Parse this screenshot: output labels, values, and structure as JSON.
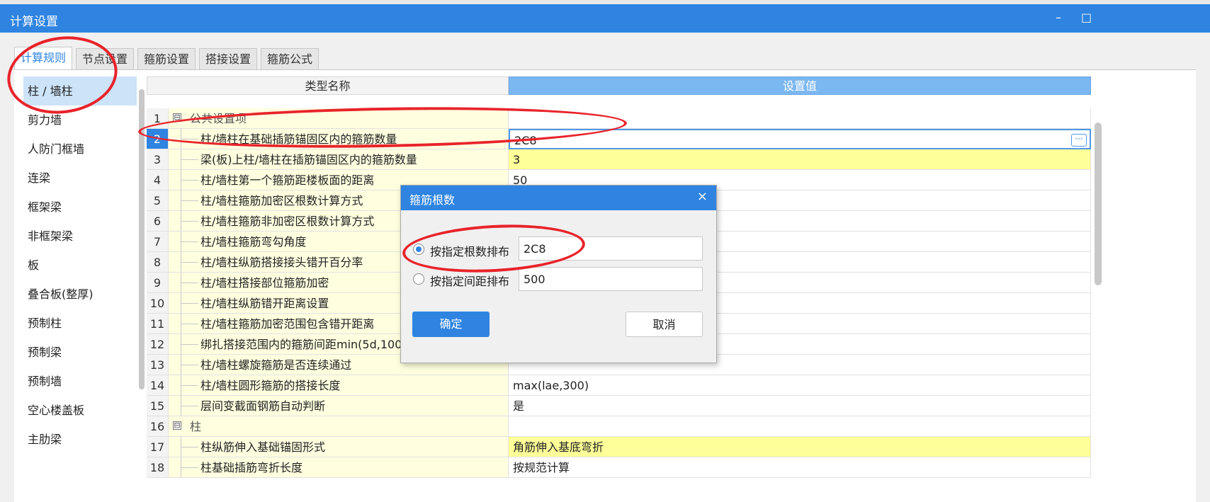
{
  "window": {
    "title": "计算设置",
    "minimize": "–",
    "maximize": "□"
  },
  "tabs": [
    {
      "label": "计算规则",
      "active": true
    },
    {
      "label": "节点设置"
    },
    {
      "label": "箍筋设置"
    },
    {
      "label": "搭接设置"
    },
    {
      "label": "箍筋公式"
    }
  ],
  "sidebar": {
    "items": [
      {
        "label": "柱 / 墙柱",
        "active": true
      },
      {
        "label": "剪力墙"
      },
      {
        "label": "人防门框墙"
      },
      {
        "label": "连梁"
      },
      {
        "label": "框架梁"
      },
      {
        "label": "非框架梁"
      },
      {
        "label": "板"
      },
      {
        "label": "叠合板(整厚)"
      },
      {
        "label": "预制柱"
      },
      {
        "label": "预制梁"
      },
      {
        "label": "预制墙"
      },
      {
        "label": "空心楼盖板"
      },
      {
        "label": "主肋梁"
      }
    ]
  },
  "grid": {
    "columns": {
      "name": "类型名称",
      "value": "设置值"
    },
    "rows": [
      {
        "num": "1",
        "group": true,
        "toggle": "⊟",
        "name": "公共设置项",
        "value": ""
      },
      {
        "num": "2",
        "name": "柱/墙柱在基础插筋锚固区内的箍筋数量",
        "value": "2C8",
        "selected": true
      },
      {
        "num": "3",
        "name": "梁(板)上柱/墙柱在插筋锚固区内的箍筋数量",
        "value": "3",
        "yellow": true
      },
      {
        "num": "4",
        "name": "柱/墙柱第一个箍筋距楼板面的距离",
        "value": "50"
      },
      {
        "num": "5",
        "name": "柱/墙柱箍筋加密区根数计算方式",
        "value": ""
      },
      {
        "num": "6",
        "name": "柱/墙柱箍筋非加密区根数计算方式",
        "value": ""
      },
      {
        "num": "7",
        "name": "柱/墙柱箍筋弯勾角度",
        "value": ""
      },
      {
        "num": "8",
        "name": "柱/墙柱纵筋搭接接头错开百分率",
        "value": ""
      },
      {
        "num": "9",
        "name": "柱/墙柱搭接部位箍筋加密",
        "value": ""
      },
      {
        "num": "10",
        "name": "柱/墙柱纵筋错开距离设置",
        "value": ""
      },
      {
        "num": "11",
        "name": "柱/墙柱箍筋加密范围包含错开距离",
        "value": ""
      },
      {
        "num": "12",
        "name": "绑扎搭接范围内的箍筋间距min(5d,100",
        "value": ""
      },
      {
        "num": "13",
        "name": "柱/墙柱螺旋箍筋是否连续通过",
        "value": ""
      },
      {
        "num": "14",
        "name": "柱/墙柱圆形箍筋的搭接长度",
        "value": "max(lae,300)"
      },
      {
        "num": "15",
        "name": "层间变截面钢筋自动判断",
        "value": "是"
      },
      {
        "num": "16",
        "group": true,
        "toggle": "⊟",
        "name": "柱",
        "value": ""
      },
      {
        "num": "17",
        "name": "柱纵筋伸入基础锚固形式",
        "value": "角筋伸入基底弯折",
        "yellow": true
      },
      {
        "num": "18",
        "name": "柱基础插筋弯折长度",
        "value": "按规范计算"
      }
    ],
    "edit_button": "···"
  },
  "dialog": {
    "title": "箍筋根数",
    "close": "×",
    "option1": {
      "label": "按指定根数排布",
      "value": "2C8",
      "checked": true
    },
    "option2": {
      "label": "按指定间距排布",
      "value": "500",
      "checked": false
    },
    "ok": "确定",
    "cancel": "取消"
  },
  "annotation_color": "#e8232a"
}
